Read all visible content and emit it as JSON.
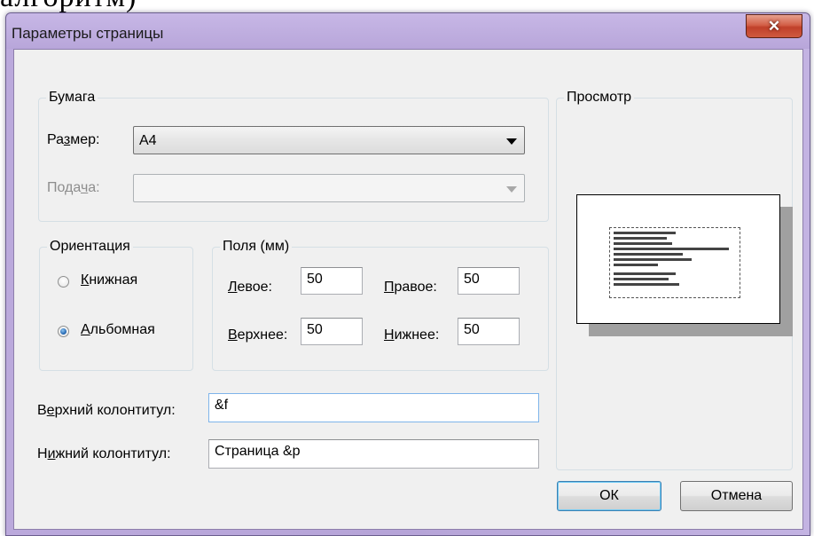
{
  "background_text": "алгоритм)",
  "window": {
    "title": "Параметры страницы",
    "close_glyph": "✕"
  },
  "paper": {
    "legend": "Бумага",
    "size_label": "Размер:",
    "size_value": "A4",
    "feed_label": "Подача:",
    "feed_value": ""
  },
  "orientation": {
    "legend": "Ориентация",
    "options": [
      {
        "label": "Книжная",
        "selected": false
      },
      {
        "label": "Альбомная",
        "selected": true
      }
    ]
  },
  "margins": {
    "legend": "Поля (мм)",
    "left_label": "Левое:",
    "left_value": "50",
    "right_label": "Правое:",
    "right_value": "50",
    "top_label": "Верхнее:",
    "top_value": "50",
    "bottom_label": "Нижнее:",
    "bottom_value": "50"
  },
  "header": {
    "label": "Верхний колонтитул:",
    "value": "&f"
  },
  "footer": {
    "label": "Нижний колонтитул:",
    "value": "Страница &p"
  },
  "preview": {
    "legend": "Просмотр"
  },
  "buttons": {
    "ok": "ОК",
    "cancel": "Отмена"
  },
  "icons": {
    "close": "close-icon",
    "dropdown": "chevron-down-icon"
  },
  "colors": {
    "title_bar": "#b8a6da",
    "close_button": "#c7432c",
    "dialog_bg": "#f0f0f0",
    "selection": "#1a5eab"
  }
}
